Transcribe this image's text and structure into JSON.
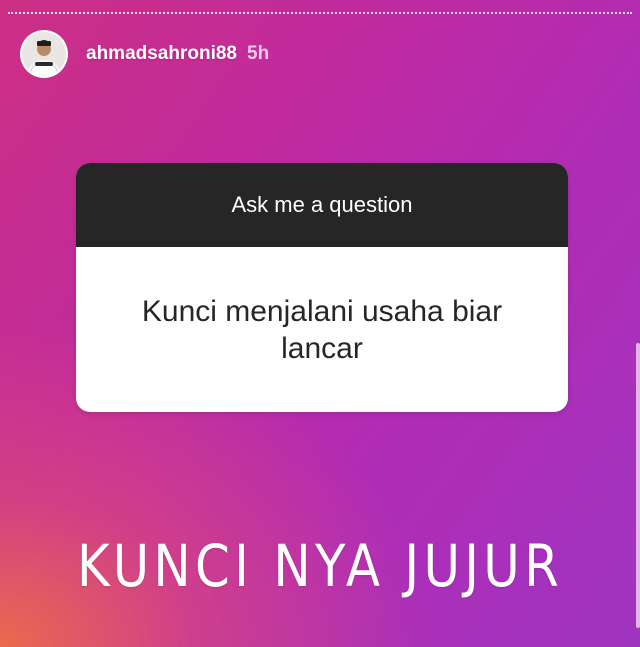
{
  "story": {
    "progress": 0.0
  },
  "header": {
    "username": "ahmadsahroni88",
    "timestamp": "5h",
    "avatar_icon": "user-avatar"
  },
  "question_sticker": {
    "prompt": "Ask me a question",
    "question": "Kunci menjalani usaha biar lancar",
    "header_color": "#262626",
    "body_color": "#ffffff"
  },
  "overlay_text": "KUNCI NYA JUJUR",
  "colors": {
    "gradient_orange": "#ec6e48",
    "gradient_pink": "#cc2f83",
    "gradient_purple": "#9f35c0",
    "text_white": "#ffffff"
  }
}
